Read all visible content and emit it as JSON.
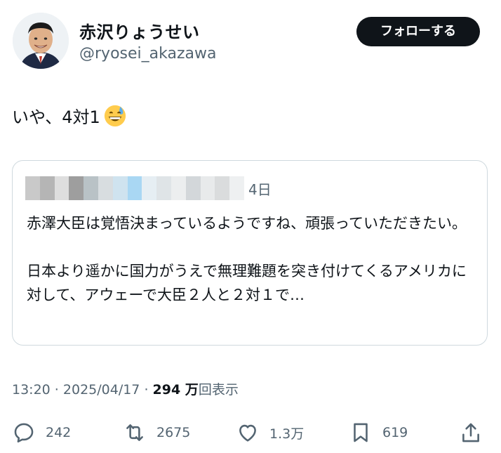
{
  "author": {
    "display_name": "赤沢りょうせい",
    "handle": "@ryosei_akazawa"
  },
  "follow_button": "フォローする",
  "tweet": {
    "text": "いや、4対1",
    "emoji": "grinning-sweat-emoji"
  },
  "quote": {
    "time": "4日",
    "text": "赤澤大臣は覚悟決まっているようですね、頑張っていただきたい。\n\n日本より遥かに国力がうえで無理難題を突き付けてくるアメリカに対して、アウェーで大臣２人と２対１で…"
  },
  "meta": {
    "time": "13:20",
    "sep1": " · ",
    "date": "2025/04/17",
    "sep2": " · ",
    "views_number": "294 万",
    "views_label": "回表示"
  },
  "actions": {
    "replies": "242",
    "retweets": "2675",
    "likes": "1.3万",
    "bookmarks": "619"
  },
  "colors": {
    "text": "#0f1419",
    "secondary": "#536471",
    "border": "#cfd9de",
    "button_bg": "#0f1419"
  }
}
